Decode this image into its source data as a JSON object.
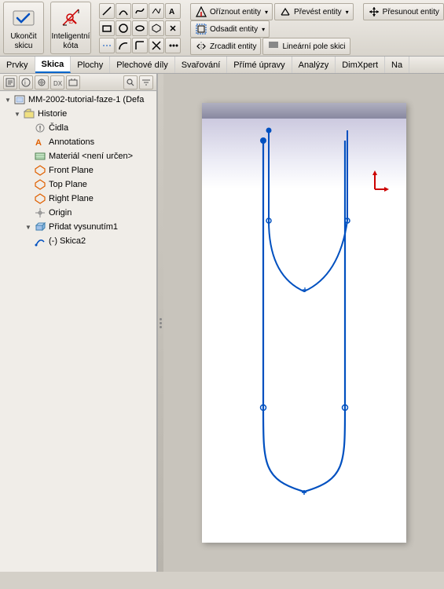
{
  "toolbar": {
    "btn_finish_label": "Ukončit skicu",
    "btn_intelligent_label": "Inteligentní kóta",
    "btn_trim_label": "Oříznout entity",
    "btn_convert_label": "Převést entity",
    "btn_offset_label": "Odsadit entity",
    "btn_mirror_label": "Zrcadlit entity",
    "btn_linear_label": "Lineární pole skici",
    "btn_move_label": "Přesunout entity"
  },
  "menubar": {
    "items": [
      "Prvky",
      "Skica",
      "Plochy",
      "Plechové díly",
      "Svařování",
      "Přímé úpravy",
      "Analýzy",
      "DimXpert",
      "Na"
    ]
  },
  "tree": {
    "root": "MM-2002-tutorial-faze-1 (Defa",
    "items": [
      {
        "label": "Historie",
        "icon": "folder",
        "indent": 1,
        "expand": true
      },
      {
        "label": "Čidla",
        "icon": "sensor",
        "indent": 2
      },
      {
        "label": "Annotations",
        "icon": "annotation",
        "indent": 2
      },
      {
        "label": "Materiál <není určen>",
        "icon": "material",
        "indent": 2
      },
      {
        "label": "Front Plane",
        "icon": "plane",
        "indent": 2
      },
      {
        "label": "Top Plane",
        "icon": "plane",
        "indent": 2
      },
      {
        "label": "Right Plane",
        "icon": "plane",
        "indent": 2
      },
      {
        "label": "Origin",
        "icon": "origin",
        "indent": 2
      },
      {
        "label": "Přidat vysunutím1",
        "icon": "feature",
        "indent": 2,
        "expand": true
      },
      {
        "label": "(-) Skica2",
        "icon": "sketch",
        "indent": 2
      }
    ]
  },
  "canvas": {
    "title": ""
  },
  "icons": {
    "finish": "✓",
    "dimension": "◇",
    "trim": "✂",
    "convert": "↔",
    "offset": "⊡",
    "mirror": "⟺",
    "linear": "▦",
    "move": "⊹",
    "folder": "📁",
    "plane": "◇",
    "origin": "⊕",
    "feature": "📦",
    "sketch": "✏"
  }
}
